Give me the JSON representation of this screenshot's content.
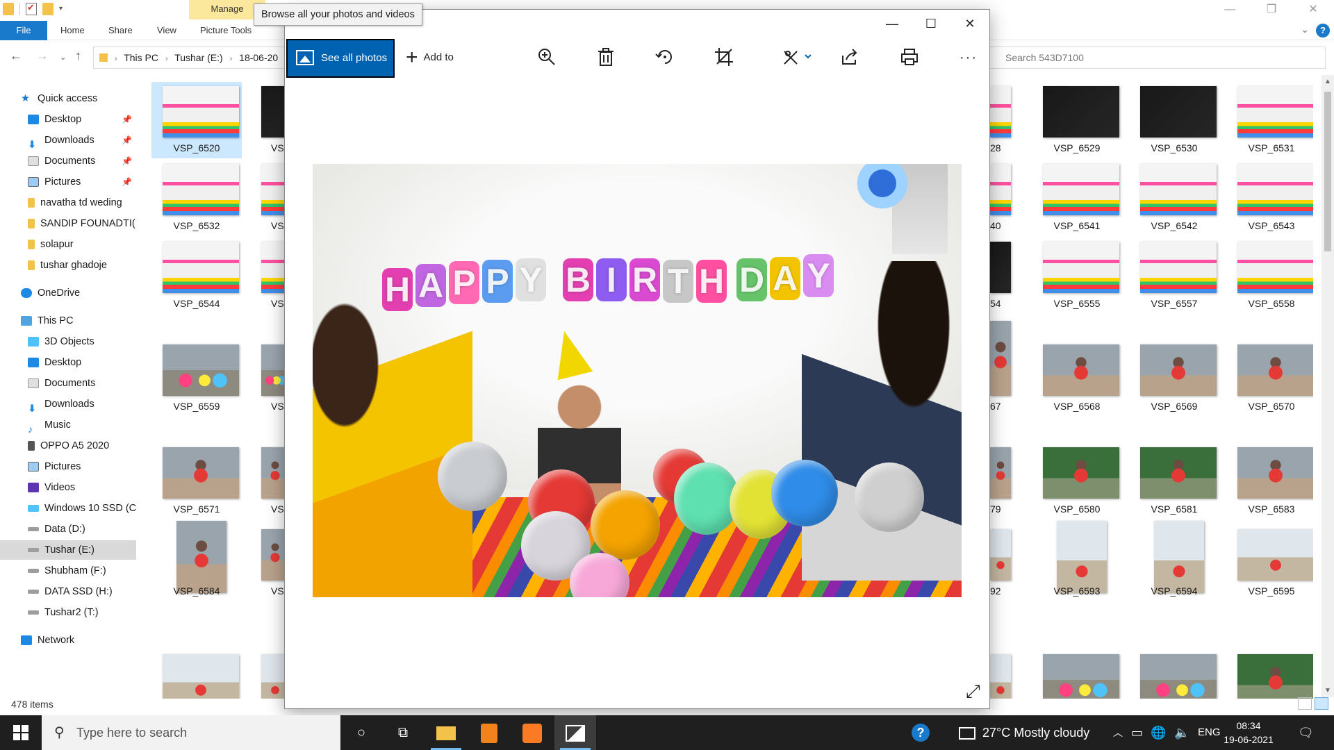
{
  "explorer": {
    "ribbon_context_tab": "Manage",
    "ribbon_tabs": [
      "File",
      "Home",
      "Share",
      "View",
      "Picture Tools"
    ],
    "address": {
      "crumbs": [
        "This PC",
        "Tushar (E:)",
        "18-06-20"
      ]
    },
    "search_placeholder": "Search 543D7100",
    "nav": {
      "quick_access": "Quick access",
      "quick_items": [
        "Desktop",
        "Downloads",
        "Documents",
        "Pictures",
        "navatha td weding",
        "SANDIP FOUNADTI(",
        "solapur",
        "tushar ghadoje"
      ],
      "onedrive": "OneDrive",
      "this_pc": "This PC",
      "pc_items": [
        "3D Objects",
        "Desktop",
        "Documents",
        "Downloads",
        "Music",
        "OPPO A5 2020",
        "Pictures",
        "Videos",
        "Windows 10 SSD (C",
        "Data (D:)",
        "Tushar (E:)",
        "Shubham (F:)",
        "DATA SSD (H:)",
        "Tushar2 (T:)"
      ],
      "network": "Network"
    },
    "thumbs_left": [
      "VSP_6520",
      "VSP_6532",
      "VSP_6544",
      "VSP_6559",
      "VSP_6571",
      "VSP_6584"
    ],
    "thumbs_left_trunc": [
      "VS",
      "VS",
      "VS",
      "VS",
      "VS",
      "VS"
    ],
    "thumbs_mid_trunc": [
      "28",
      "40",
      "54",
      "67",
      "79",
      "92"
    ],
    "thumbs_right": [
      [
        "VSP_6529",
        "VSP_6530",
        "VSP_6531"
      ],
      [
        "VSP_6541",
        "VSP_6542",
        "VSP_6543"
      ],
      [
        "VSP_6555",
        "VSP_6557",
        "VSP_6558"
      ],
      [
        "VSP_6568",
        "VSP_6569",
        "VSP_6570"
      ],
      [
        "VSP_6580",
        "VSP_6581",
        "VSP_6583"
      ],
      [
        "VSP_6593",
        "VSP_6594",
        "VSP_6595"
      ]
    ],
    "status": "478 items"
  },
  "photos": {
    "tooltip": "Browse all your photos and videos",
    "see_all": "See all photos",
    "add_to": "Add to",
    "banner_text": "HAPPY BIRTHDAY"
  },
  "taskbar": {
    "search_placeholder": "Type here to search",
    "weather": "27°C  Mostly cloudy",
    "lang": "ENG",
    "time": "08:34",
    "date": "19-06-2021"
  }
}
